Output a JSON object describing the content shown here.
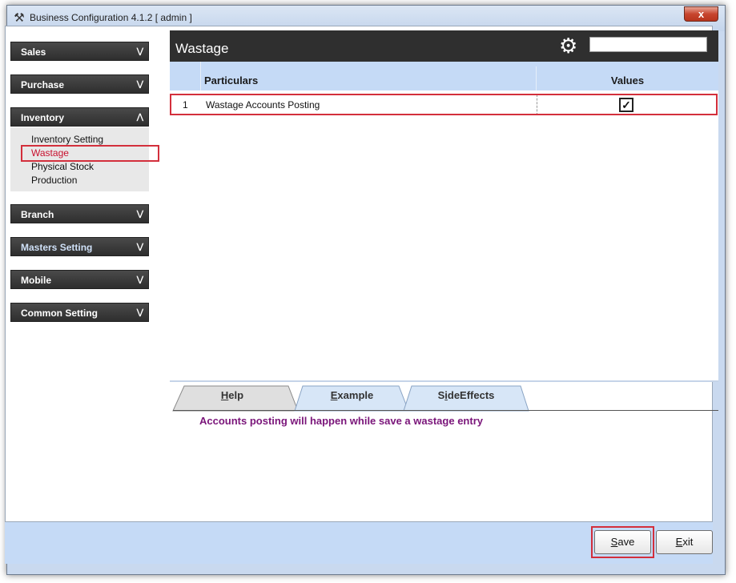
{
  "window": {
    "title": "Business Configuration 4.1.2 [ admin ]",
    "close_label": "x"
  },
  "sidebar": {
    "sections": [
      {
        "label": "Sales",
        "expanded": false
      },
      {
        "label": "Purchase",
        "expanded": false
      },
      {
        "label": "Inventory",
        "expanded": true
      },
      {
        "label": "Branch",
        "expanded": false
      },
      {
        "label": "Masters Setting",
        "expanded": false
      },
      {
        "label": "Mobile",
        "expanded": false
      },
      {
        "label": "Common Setting",
        "expanded": false
      }
    ],
    "inventory_items": [
      "Inventory Setting",
      "Wastage",
      "Physical Stock",
      "Production"
    ],
    "active_item": "Wastage"
  },
  "main": {
    "title": "Wastage",
    "search_value": "",
    "columns": {
      "particulars": "Particulars",
      "values": "Values"
    },
    "rows": [
      {
        "num": "1",
        "particular": "Wastage Accounts Posting",
        "checked": true
      }
    ]
  },
  "tabs": {
    "help": {
      "accel": "H",
      "rest": "elp"
    },
    "example": {
      "accel": "E",
      "rest": "xample"
    },
    "sideeffects": {
      "pre": "S",
      "accel": "i",
      "rest": "deEffects"
    }
  },
  "help_text": "Accounts posting will happen while save a wastage entry",
  "footer": {
    "save": {
      "accel": "S",
      "rest": "ave"
    },
    "exit": {
      "accel": "E",
      "rest": "xit"
    }
  },
  "colors": {
    "accent_dark": "#2f2f2f",
    "header_blue": "#c5daf6",
    "highlight_red": "#d32f3c",
    "help_purple": "#7a157a"
  }
}
